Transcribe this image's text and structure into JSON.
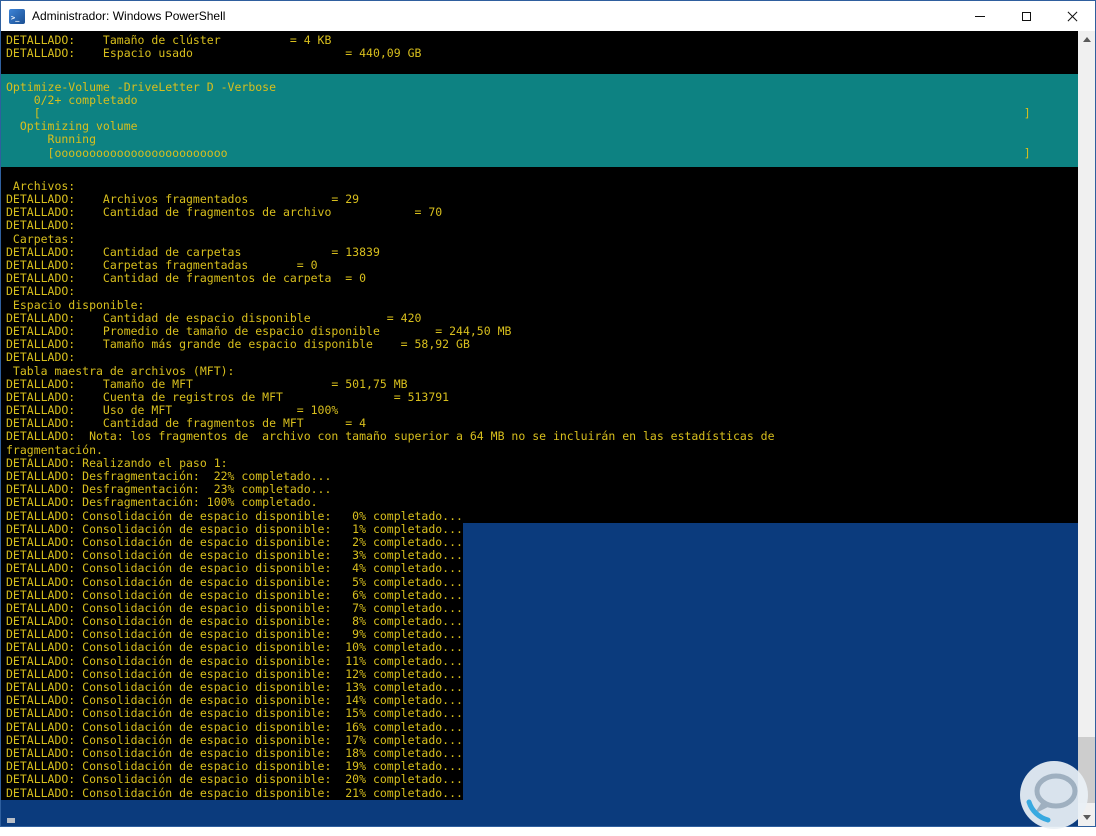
{
  "window": {
    "title": "Administrador: Windows PowerShell",
    "icons": [
      "powershell-icon",
      "minimize-icon",
      "maximize-icon",
      "close-icon",
      "scroll-up-icon",
      "scroll-down-icon",
      "speech-bubble-icon"
    ]
  },
  "colors": {
    "console-blue": "#0b3b7d",
    "console-black": "#000000",
    "progress-teal": "#0d8282",
    "console-yellow": "#d8bf1d",
    "titlebar-bg": "#ffffff",
    "titlebar-text": "#000000",
    "scrollbar-track": "#f0f0f0",
    "scrollbar-thumb": "#cdcdcd"
  },
  "console": {
    "pre_lines": [
      "DETALLADO:    Tamaño de clúster          = 4 KB",
      "DETALLADO:    Espacio usado                      = 440,09 GB",
      ""
    ],
    "progress_lines": [
      "Optimize-Volume -DriveLetter D -Verbose",
      "    0/2+ completado",
      "    [                                                                                                                                              ]",
      "  Optimizing volume",
      "      Running",
      "      [ooooooooooooooooooooooooo                                                                                                                   ]"
    ],
    "mid_lines": [
      "",
      " Archivos:",
      "DETALLADO:    Archivos fragmentados            = 29",
      "DETALLADO:    Cantidad de fragmentos de archivo            = 70",
      "DETALLADO:",
      " Carpetas:",
      "DETALLADO:    Cantidad de carpetas             = 13839",
      "DETALLADO:    Carpetas fragmentadas       = 0",
      "DETALLADO:    Cantidad de fragmentos de carpeta  = 0",
      "DETALLADO:",
      " Espacio disponible:",
      "DETALLADO:    Cantidad de espacio disponible           = 420",
      "DETALLADO:    Promedio de tamaño de espacio disponible        = 244,50 MB",
      "DETALLADO:    Tamaño más grande de espacio disponible    = 58,92 GB",
      "DETALLADO:",
      " Tabla maestra de archivos (MFT):",
      "DETALLADO:    Tamaño de MFT                    = 501,75 MB",
      "DETALLADO:    Cuenta de registros de MFT                = 513791",
      "DETALLADO:    Uso de MFT                  = 100%",
      "DETALLADO:    Cantidad de fragmentos de MFT      = 4",
      "DETALLADO:  Nota: los fragmentos de  archivo con tamaño superior a 64 MB no se incluirán en las estadísticas de",
      "fragmentación.",
      "DETALLADO: Realizando el paso 1:",
      "DETALLADO: Desfragmentación:  22% completado...",
      "DETALLADO: Desfragmentación:  23% completado...",
      "DETALLADO: Desfragmentación: 100% completado.",
      "DETALLADO: Consolidación de espacio disponible:   0% completado..."
    ],
    "tail_lines": [
      "DETALLADO: Consolidación de espacio disponible:   1% completado...",
      "DETALLADO: Consolidación de espacio disponible:   2% completado...",
      "DETALLADO: Consolidación de espacio disponible:   3% completado...",
      "DETALLADO: Consolidación de espacio disponible:   4% completado...",
      "DETALLADO: Consolidación de espacio disponible:   5% completado...",
      "DETALLADO: Consolidación de espacio disponible:   6% completado...",
      "DETALLADO: Consolidación de espacio disponible:   7% completado...",
      "DETALLADO: Consolidación de espacio disponible:   8% completado...",
      "DETALLADO: Consolidación de espacio disponible:   9% completado...",
      "DETALLADO: Consolidación de espacio disponible:  10% completado...",
      "DETALLADO: Consolidación de espacio disponible:  11% completado...",
      "DETALLADO: Consolidación de espacio disponible:  12% completado...",
      "DETALLADO: Consolidación de espacio disponible:  13% completado...",
      "DETALLADO: Consolidación de espacio disponible:  14% completado...",
      "DETALLADO: Consolidación de espacio disponible:  15% completado...",
      "DETALLADO: Consolidación de espacio disponible:  16% completado...",
      "DETALLADO: Consolidación de espacio disponible:  17% completado...",
      "DETALLADO: Consolidación de espacio disponible:  18% completado...",
      "DETALLADO: Consolidación de espacio disponible:  19% completado...",
      "DETALLADO: Consolidación de espacio disponible:  20% completado...",
      "DETALLADO: Consolidación de espacio disponible:  21% completado..."
    ]
  }
}
